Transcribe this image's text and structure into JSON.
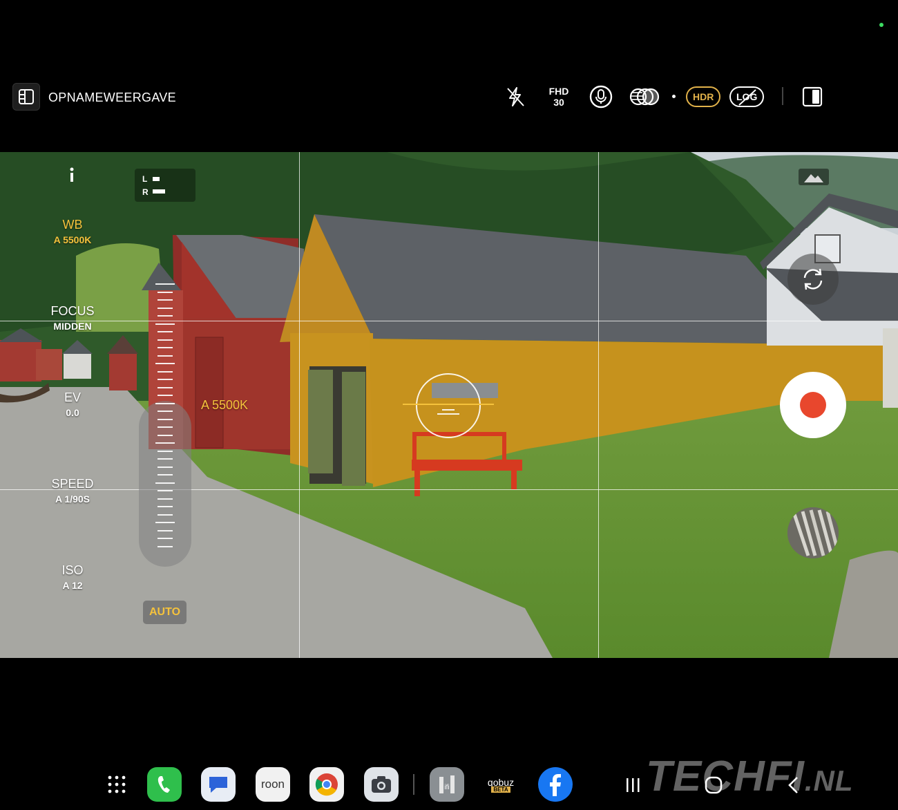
{
  "top_bar": {
    "mode_label": "OPNAMEWEERGAVE",
    "resolution": "FHD",
    "framerate": "30",
    "hdr_label": "HDR",
    "log_label": "LOG"
  },
  "pro_controls": {
    "wb": {
      "label": "WB",
      "value": "A 5500K"
    },
    "focus": {
      "label": "FOCUS",
      "value": "MIDDEN"
    },
    "ev": {
      "label": "EV",
      "value": "0.0"
    },
    "speed": {
      "label": "SPEED",
      "value": "A 1/90S"
    },
    "iso": {
      "label": "ISO",
      "value": "A 12"
    }
  },
  "audio_meter": {
    "left": "L",
    "right": "R"
  },
  "auto_button": "AUTO",
  "wb_overlay_value": "A 5500K",
  "taskbar": {
    "apps": [
      "app-drawer",
      "phone",
      "messages",
      "roon",
      "chrome",
      "camera",
      "ifi",
      "qobuz",
      "facebook"
    ],
    "roon_label": "roon",
    "qobuz_label": "qobuz",
    "qobuz_badge": "BETA"
  },
  "watermark": {
    "main": "TECHFI",
    "domain": ".NL"
  },
  "colors": {
    "accent": "#f5c23c",
    "record": "#e8472d",
    "status_dot": "#3ddc62"
  }
}
